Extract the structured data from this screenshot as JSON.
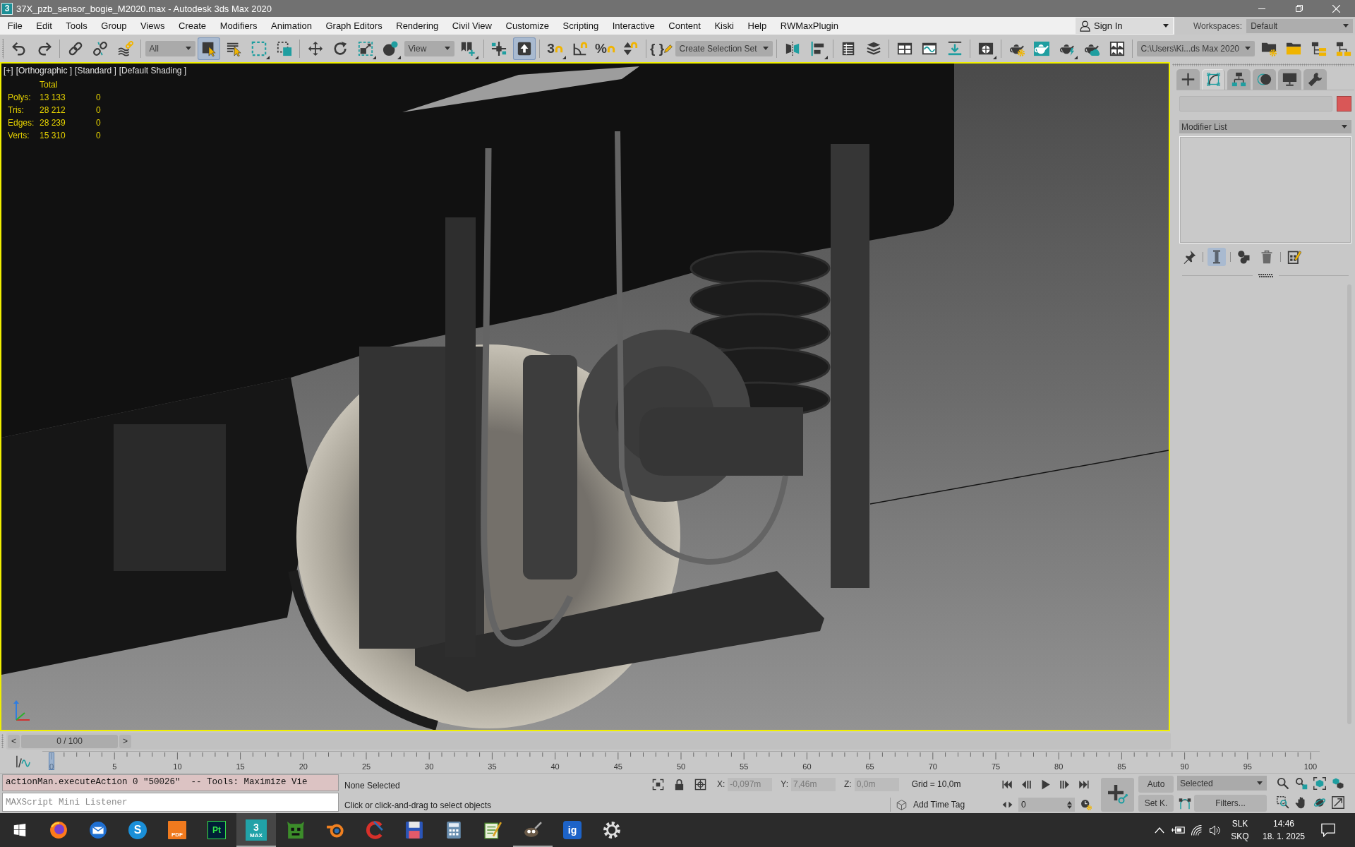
{
  "window": {
    "icon_label": "3",
    "title": "37X_pzb_sensor_bogie_M2020.max - Autodesk 3ds Max 2020"
  },
  "menu_bar": {
    "items": [
      "File",
      "Edit",
      "Tools",
      "Group",
      "Views",
      "Create",
      "Modifiers",
      "Animation",
      "Graph Editors",
      "Rendering",
      "Civil View",
      "Customize",
      "Scripting",
      "Interactive",
      "Content",
      "Kiski",
      "Help",
      "RWMaxPlugin"
    ],
    "sign_in": "Sign In",
    "workspaces_label": "Workspaces:",
    "workspace": "Default"
  },
  "toolbar": {
    "groups": [
      [
        {
          "kind": "button",
          "on": false
        },
        {
          "kind": "button",
          "on": false
        }
      ],
      [
        {
          "kind": "button",
          "on": false
        },
        {
          "kind": "button",
          "on": false
        },
        {
          "kind": "button",
          "on": false
        }
      ],
      [
        {
          "kind": "dropdown",
          "value": "All"
        },
        {
          "kind": "button",
          "on": true
        },
        {
          "kind": "button",
          "on": false
        },
        {
          "kind": "button",
          "on": false,
          "flyout": true
        },
        {
          "kind": "button",
          "on": false
        }
      ],
      [
        {
          "kind": "button",
          "on": false
        },
        {
          "kind": "button",
          "on": false
        },
        {
          "kind": "button",
          "on": false,
          "flyout": true
        },
        {
          "kind": "button",
          "on": false,
          "flyout": true
        },
        {
          "kind": "dropdown",
          "value": "View"
        },
        {
          "kind": "button",
          "on": false,
          "flyout": true
        }
      ],
      [
        {
          "kind": "button",
          "on": false
        },
        {
          "kind": "button",
          "on": true
        }
      ],
      [
        {
          "kind": "button",
          "on": false,
          "label": "3",
          "flyout": true
        },
        {
          "kind": "button",
          "on": false
        },
        {
          "kind": "button",
          "on": false,
          "label": "%"
        },
        {
          "kind": "button",
          "on": false
        }
      ],
      [
        {
          "kind": "button",
          "on": false,
          "label": "{ }"
        },
        {
          "kind": "dropdown",
          "value": "Create Selection Set"
        }
      ],
      [
        {
          "kind": "button",
          "on": false
        },
        {
          "kind": "button",
          "on": false,
          "flyout": true
        }
      ],
      [
        {
          "kind": "button",
          "on": false
        },
        {
          "kind": "button",
          "on": false
        }
      ],
      [
        {
          "kind": "button",
          "on": false
        },
        {
          "kind": "button",
          "on": false
        },
        {
          "kind": "button",
          "on": false
        }
      ],
      [
        {
          "kind": "button",
          "on": false,
          "flyout": true
        }
      ],
      [
        {
          "kind": "button",
          "on": false
        },
        {
          "kind": "button",
          "on": false
        },
        {
          "kind": "button",
          "on": false,
          "flyout": true
        },
        {
          "kind": "button",
          "on": false
        },
        {
          "kind": "button",
          "on": false
        }
      ],
      [
        {
          "kind": "dropdown",
          "value": "C:\\Users\\Ki...ds Max 2020"
        },
        {
          "kind": "button",
          "on": false
        },
        {
          "kind": "button",
          "on": false
        },
        {
          "kind": "button",
          "on": false
        },
        {
          "kind": "button",
          "on": false
        }
      ]
    ]
  },
  "viewport": {
    "active": true,
    "labels": [
      "[+]",
      "[Orthographic ]",
      "[Standard ]",
      "[Default Shading ]"
    ],
    "stats": {
      "columns": [
        "Total"
      ],
      "rows": [
        {
          "label": "Polys:",
          "values": [
            "13 133",
            "0"
          ]
        },
        {
          "label": "Tris:",
          "values": [
            "28 212",
            "0"
          ]
        },
        {
          "label": "Edges:",
          "values": [
            "28 239",
            "0"
          ]
        },
        {
          "label": "Verts:",
          "values": [
            "15 310",
            "0"
          ]
        }
      ]
    }
  },
  "command_panel": {
    "tabs": [
      {
        "selected": false
      },
      {
        "selected": true
      },
      {
        "selected": false
      },
      {
        "selected": false
      },
      {
        "selected": false
      },
      {
        "selected": false
      }
    ],
    "modifier_list": "Modifier List",
    "stack_buttons": [
      [
        {
          "on": false
        }
      ],
      [
        {
          "on": true
        }
      ],
      [
        {
          "on": false
        },
        {
          "on": false
        }
      ],
      [
        {
          "on": false
        }
      ]
    ]
  },
  "time_slider": {
    "previous": "<",
    "frame": "0 / 100",
    "next": ">",
    "level": 0
  },
  "track_bar": {
    "labels": [
      "0",
      "5",
      "10",
      "15",
      "20",
      "25",
      "30",
      "35",
      "40",
      "45",
      "50",
      "55",
      "60",
      "65",
      "70",
      "75",
      "80",
      "85",
      "90",
      "95",
      "100"
    ]
  },
  "listener": {
    "output": "actionMan.executeAction 0 \"50026\"  -- Tools: Maximize Vie",
    "placeholder": "MAXScript Mini Listener"
  },
  "status": {
    "selection": "None Selected",
    "prompt": "Click or click-and-drag to select objects",
    "coordinates": [
      {
        "label": "X:",
        "value": "-0,097m",
        "disabled": true
      },
      {
        "label": "Y:",
        "value": "7,46m",
        "disabled": true
      },
      {
        "label": "Z:",
        "value": "0,0m",
        "disabled": true
      }
    ],
    "grid": "Grid = 10,0m",
    "time_tag": "Add Time Tag"
  },
  "animation": {
    "frame": "0",
    "auto_key": {
      "label": "Auto",
      "on": false
    },
    "set_key": "Set K.",
    "key_set": "Selected",
    "filters": "Filters..."
  },
  "taskbar": {
    "apps": [
      {
        "selected": false,
        "running": false
      },
      {
        "selected": false,
        "running": false
      },
      {
        "label": "S",
        "selected": false,
        "running": false
      },
      {
        "label": "PDF",
        "selected": false,
        "running": false
      },
      {
        "label": "Pt",
        "selected": false,
        "running": false
      },
      {
        "label": "3",
        "caption": "MAX",
        "selected": true,
        "running": true
      },
      {
        "selected": false,
        "running": false
      },
      {
        "selected": false,
        "running": false
      },
      {
        "selected": false,
        "running": false
      },
      {
        "selected": false,
        "running": false
      },
      {
        "selected": false,
        "running": false
      },
      {
        "selected": false,
        "running": false
      },
      {
        "selected": false,
        "running": true
      },
      {
        "label": "ig",
        "selected": false,
        "running": false
      },
      {
        "selected": false,
        "running": false
      }
    ],
    "language": [
      "SLK",
      "SKQ"
    ],
    "time": "14:46",
    "date": "18. 1. 2025"
  }
}
